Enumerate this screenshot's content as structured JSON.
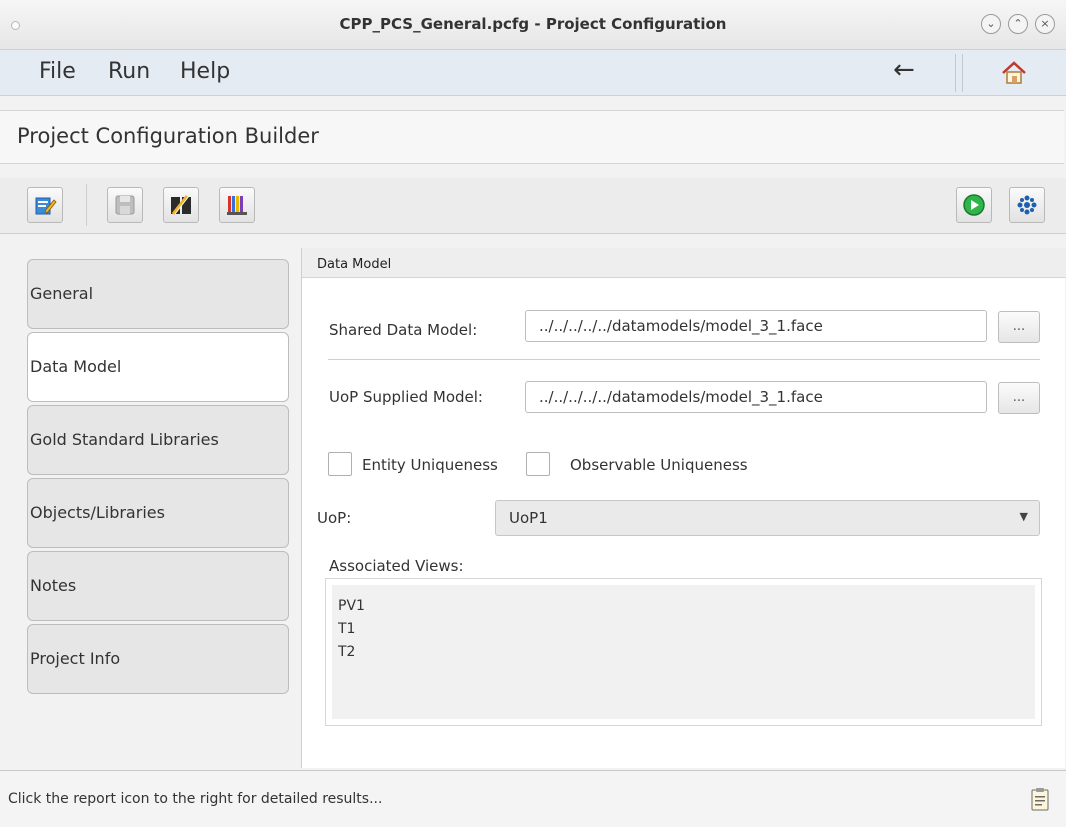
{
  "window": {
    "title": "CPP_PCS_General.pcfg - Project Configuration",
    "buttons": {
      "minimize": "⌄",
      "maximize": "⌃",
      "close": "×"
    }
  },
  "menubar": {
    "items": [
      "File",
      "Run",
      "Help"
    ],
    "back_icon": "←"
  },
  "header": {
    "title": "Project Configuration Builder"
  },
  "toolbar": {
    "icons": [
      "edit-icon",
      "save-icon",
      "clear-icon",
      "library-icon",
      "run-icon",
      "settings-icon"
    ]
  },
  "sidebar": {
    "tabs": [
      {
        "label": "General"
      },
      {
        "label": "Data Model"
      },
      {
        "label": "Gold Standard Libraries"
      },
      {
        "label": "Objects/Libraries"
      },
      {
        "label": "Notes"
      },
      {
        "label": "Project Info"
      }
    ],
    "active": "Data Model"
  },
  "panel": {
    "title": "Data Model",
    "shared_label": "Shared Data Model:",
    "shared_value": "../../../../../datamodels/model_3_1.face",
    "uop_supplied_label": "UoP Supplied Model:",
    "uop_supplied_value": "../../../../../datamodels/model_3_1.face",
    "browse_label": "...",
    "entity_uniqueness_label": "Entity Uniqueness",
    "observable_uniqueness_label": "Observable Uniqueness",
    "uop_label": "UoP:",
    "uop_value": "UoP1",
    "associated_label": "Associated Views:",
    "views": [
      "PV1",
      "T1",
      "T2"
    ]
  },
  "status": {
    "text": "Click the report icon to the right for detailed results..."
  },
  "colors": {
    "menubar_bg": "#e4ebf3",
    "run_green": "#2fb54a",
    "settings_blue": "#1f5fae"
  }
}
